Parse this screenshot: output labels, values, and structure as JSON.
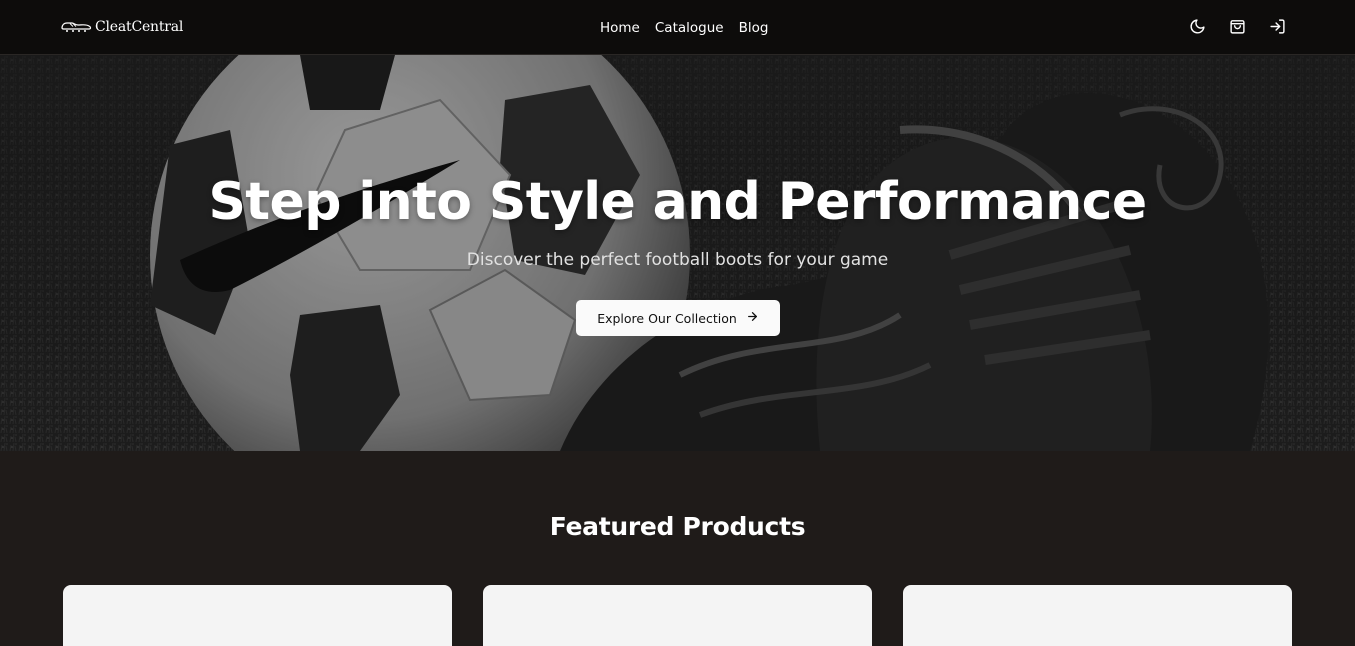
{
  "header": {
    "logo_text": "CleatCentral",
    "nav": [
      {
        "label": "Home"
      },
      {
        "label": "Catalogue"
      },
      {
        "label": "Blog"
      }
    ],
    "icons": [
      "moon-icon",
      "shopping-bag-icon",
      "login-icon"
    ]
  },
  "hero": {
    "title": "Step into Style and Performance",
    "subtitle": "Discover the perfect football boots for your game",
    "cta_label": "Explore Our Collection",
    "cta_icon": "arrow-right-icon"
  },
  "featured": {
    "title": "Featured Products",
    "cards": [
      {},
      {},
      {}
    ]
  },
  "colors": {
    "header_bg": "#0d0c0b",
    "page_bg": "#1f1b19",
    "card_bg": "#f4f4f4",
    "button_bg": "#fafafa"
  }
}
